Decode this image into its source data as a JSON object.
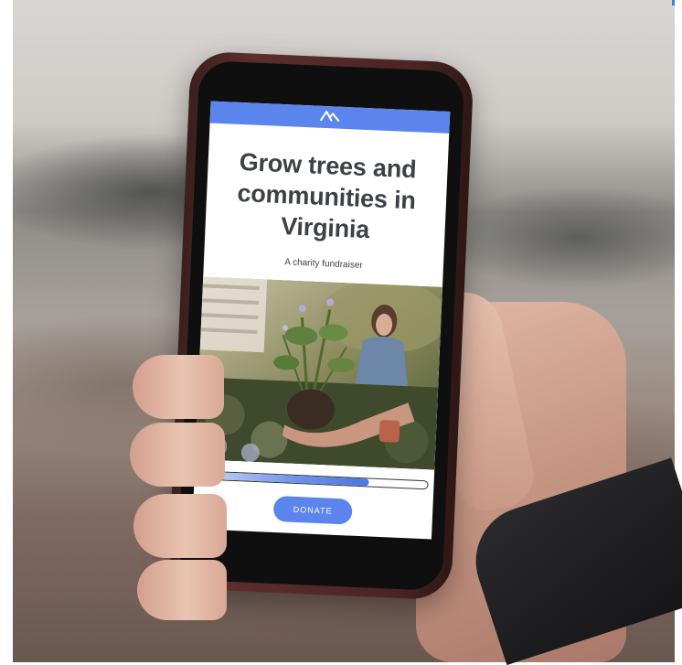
{
  "brand": {
    "icon": "mountain-logo-icon",
    "accent_color": "#5b84ec"
  },
  "hero": {
    "headline_line1": "Grow trees and",
    "headline_line2": "communities in",
    "headline_line3": "Virginia",
    "subline": "A charity fundraiser"
  },
  "campaign": {
    "progress_fraction": 0.74
  },
  "cta": {
    "donate_label": "DONATE"
  }
}
